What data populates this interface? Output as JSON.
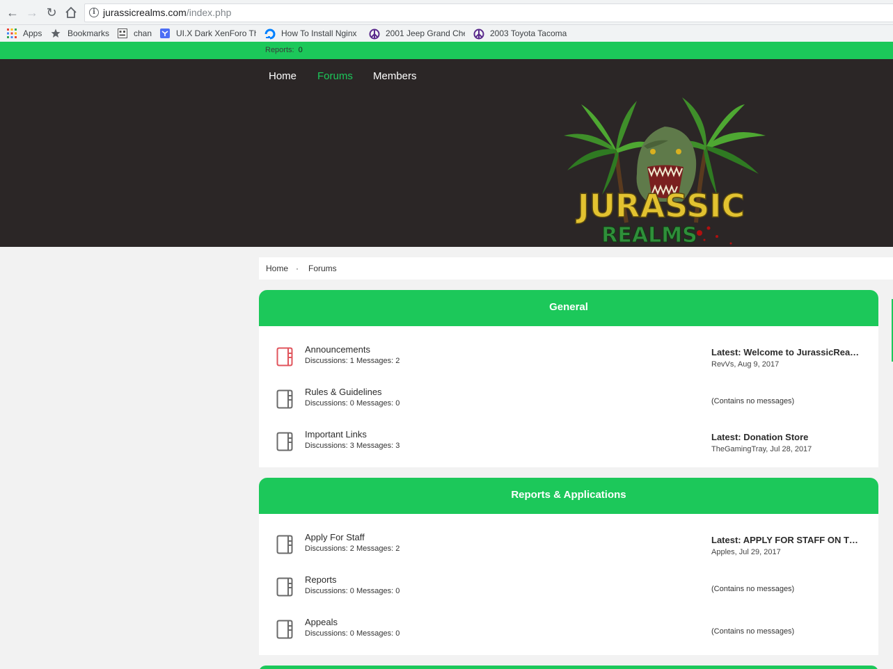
{
  "browser": {
    "url_host": "jurassicrealms.com",
    "url_path": "/index.php",
    "bookmarks": [
      {
        "label": "Apps",
        "icon": "apps-grid-icon"
      },
      {
        "label": "Bookmarks",
        "icon": "star-icon"
      },
      {
        "label": "chan",
        "icon": "chan-icon"
      },
      {
        "label": "UI.X Dark XenForo Th",
        "icon": "xenforo-icon"
      },
      {
        "label": "How To Install Nginx",
        "icon": "digitalocean-icon"
      },
      {
        "label": "2001 Jeep Grand Che",
        "icon": "peace-icon"
      },
      {
        "label": "2003 Toyota Tacoma",
        "icon": "peace-icon"
      }
    ]
  },
  "topbar": {
    "reports_label": "Reports:",
    "reports_count": "0"
  },
  "nav": {
    "home": "Home",
    "forums": "Forums",
    "members": "Members"
  },
  "logo": {
    "line1": "JURASSIC",
    "line2": "REALMS"
  },
  "breadcrumb": {
    "home": "Home",
    "sep": "·",
    "current": "Forums"
  },
  "colors": {
    "accent": "#1cc85a",
    "header_bg": "#2b2626",
    "announce_icon": "#e0545c"
  },
  "categories": [
    {
      "title": "General",
      "forums": [
        {
          "name": "Announcements",
          "stats": "Discussions: 1 Messages: 2",
          "latest": "Latest: Welcome to JurassicRealms!",
          "meta": "RevVs, Aug 9, 2017",
          "highlight": true
        },
        {
          "name": "Rules & Guidelines",
          "stats": "Discussions: 0 Messages: 0",
          "empty": "(Contains no messages)"
        },
        {
          "name": "Important Links",
          "stats": "Discussions: 3 Messages: 3",
          "latest": "Latest: Donation Store",
          "meta": "TheGamingTray, Jul 28, 2017"
        }
      ]
    },
    {
      "title": "Reports & Applications",
      "forums": [
        {
          "name": "Apply For Staff",
          "stats": "Discussions: 2 Messages: 2",
          "latest": "Latest: APPLY FOR STAFF ON THE FORUMS",
          "meta": "Apples, Jul 29, 2017"
        },
        {
          "name": "Reports",
          "stats": "Discussions: 0 Messages: 0",
          "empty": "(Contains no messages)"
        },
        {
          "name": "Appeals",
          "stats": "Discussions: 0 Messages: 0",
          "empty": "(Contains no messages)"
        }
      ]
    }
  ]
}
